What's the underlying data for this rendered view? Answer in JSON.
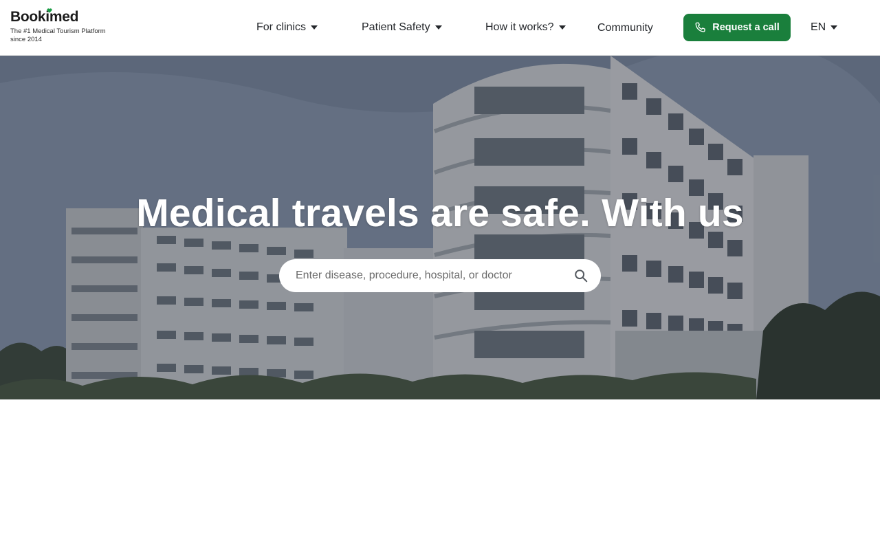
{
  "logo": {
    "wordmark": "Bookimed",
    "tagline": "The #1 Medical Tourism Platform since 2014"
  },
  "nav": {
    "for_clinics": "For clinics",
    "patient_safety": "Patient Safety",
    "how_it_works": "How it works?",
    "community": "Community"
  },
  "cta": {
    "label": "Request a call"
  },
  "language": {
    "current": "EN"
  },
  "hero": {
    "title": "Medical travels are safe. With us",
    "search_placeholder": "Enter disease, procedure, hospital, or doctor"
  },
  "icons": {
    "caret": "chevron-down-icon",
    "phone": "phone-icon",
    "search": "search-icon",
    "heart": "heart-icon"
  },
  "colors": {
    "brand_green": "#1a7f3c",
    "text_dark": "#24272b",
    "white": "#ffffff"
  }
}
